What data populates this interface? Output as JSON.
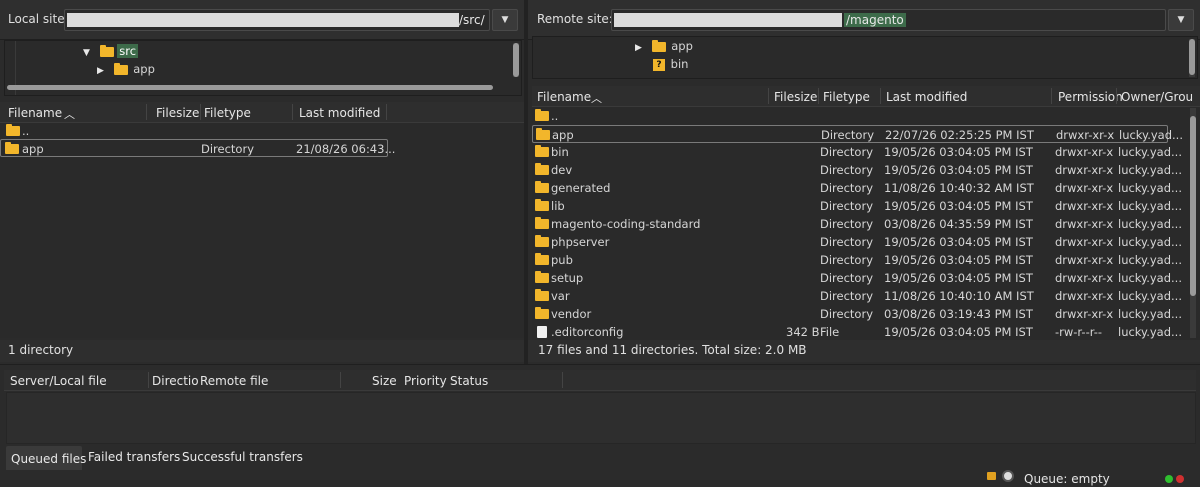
{
  "local": {
    "site_label": "Local site:",
    "path_suffix": "/src/",
    "tree": {
      "src_label": "src",
      "app_label": "app"
    },
    "columns": {
      "filename": "Filename",
      "filesize": "Filesize",
      "filetype": "Filetype",
      "last_modified": "Last modified"
    },
    "rows": [
      {
        "name": "..",
        "size": "",
        "type": "",
        "modified": ""
      },
      {
        "name": "app",
        "size": "",
        "type": "Directory",
        "modified": "21/08/26 06:43..."
      }
    ],
    "status": "1 directory"
  },
  "remote": {
    "site_label": "Remote site:",
    "path_suffix": "/magento",
    "tree": {
      "app_label": "app",
      "bin_label": "bin"
    },
    "columns": {
      "filename": "Filename",
      "filesize": "Filesize",
      "filetype": "Filetype",
      "last_modified": "Last modified",
      "permission": "Permission",
      "owner": "Owner/Grou"
    },
    "rows": [
      {
        "name": "..",
        "size": "",
        "type": "",
        "modified": "",
        "perm": "",
        "owner": "",
        "icon": "folder"
      },
      {
        "name": "app",
        "size": "",
        "type": "Directory",
        "modified": "22/07/26 02:25:25 PM IST",
        "perm": "drwxr-xr-x",
        "owner": "lucky.yad...",
        "icon": "folder"
      },
      {
        "name": "bin",
        "size": "",
        "type": "Directory",
        "modified": "19/05/26 03:04:05 PM IST",
        "perm": "drwxr-xr-x",
        "owner": "lucky.yad...",
        "icon": "folder"
      },
      {
        "name": "dev",
        "size": "",
        "type": "Directory",
        "modified": "19/05/26 03:04:05 PM IST",
        "perm": "drwxr-xr-x",
        "owner": "lucky.yad...",
        "icon": "folder"
      },
      {
        "name": "generated",
        "size": "",
        "type": "Directory",
        "modified": "11/08/26 10:40:32 AM IST",
        "perm": "drwxr-xr-x",
        "owner": "lucky.yad...",
        "icon": "folder"
      },
      {
        "name": "lib",
        "size": "",
        "type": "Directory",
        "modified": "19/05/26 03:04:05 PM IST",
        "perm": "drwxr-xr-x",
        "owner": "lucky.yad...",
        "icon": "folder"
      },
      {
        "name": "magento-coding-standard",
        "size": "",
        "type": "Directory",
        "modified": "03/08/26 04:35:59 PM IST",
        "perm": "drwxr-xr-x",
        "owner": "lucky.yad...",
        "icon": "folder"
      },
      {
        "name": "phpserver",
        "size": "",
        "type": "Directory",
        "modified": "19/05/26 03:04:05 PM IST",
        "perm": "drwxr-xr-x",
        "owner": "lucky.yad...",
        "icon": "folder"
      },
      {
        "name": "pub",
        "size": "",
        "type": "Directory",
        "modified": "19/05/26 03:04:05 PM IST",
        "perm": "drwxr-xr-x",
        "owner": "lucky.yad...",
        "icon": "folder"
      },
      {
        "name": "setup",
        "size": "",
        "type": "Directory",
        "modified": "19/05/26 03:04:05 PM IST",
        "perm": "drwxr-xr-x",
        "owner": "lucky.yad...",
        "icon": "folder"
      },
      {
        "name": "var",
        "size": "",
        "type": "Directory",
        "modified": "11/08/26 10:40:10 AM IST",
        "perm": "drwxr-xr-x",
        "owner": "lucky.yad...",
        "icon": "folder"
      },
      {
        "name": "vendor",
        "size": "",
        "type": "Directory",
        "modified": "03/08/26 03:19:43 PM IST",
        "perm": "drwxr-xr-x",
        "owner": "lucky.yad...",
        "icon": "folder"
      },
      {
        "name": ".editorconfig",
        "size": "342 B",
        "type": "File",
        "modified": "19/05/26 03:04:05 PM IST",
        "perm": "-rw-r--r--",
        "owner": "lucky.yad...",
        "icon": "file"
      }
    ],
    "status": "17 files and 11 directories. Total size: 2.0 MB"
  },
  "queue": {
    "columns": {
      "server_local": "Server/Local file",
      "direction": "Directio",
      "remote": "Remote file",
      "size": "Size",
      "priority": "Priority",
      "status": "Status"
    },
    "tabs": {
      "queued": "Queued files",
      "failed": "Failed transfers",
      "successful": "Successful transfers"
    },
    "status_text": "Queue: empty"
  },
  "colors": {
    "folder": "#f2b62b",
    "background": "#2b2b2b",
    "led_green": "#2fbf2f",
    "led_red": "#d03030"
  }
}
